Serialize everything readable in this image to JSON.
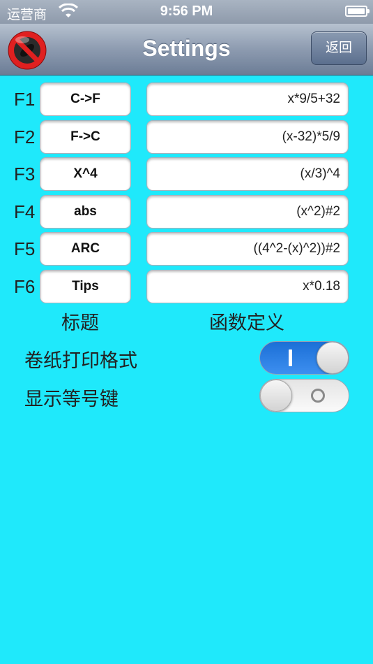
{
  "status_bar": {
    "carrier": "运营商",
    "time": "9:56 PM"
  },
  "nav": {
    "title": "Settings",
    "back_label": "返回",
    "left_icon": "no-symbol-icon"
  },
  "functions": [
    {
      "key": "F1",
      "title": "C->F",
      "definition": "x*9/5+32"
    },
    {
      "key": "F2",
      "title": "F->C",
      "definition": "(x-32)*5/9"
    },
    {
      "key": "F3",
      "title": "X^4",
      "definition": "(x/3)^4"
    },
    {
      "key": "F4",
      "title": "abs",
      "definition": "(x^2)#2"
    },
    {
      "key": "F5",
      "title": "ARC",
      "definition": "((4^2-(x)^2))#2"
    },
    {
      "key": "F6",
      "title": "Tips",
      "definition": "x*0.18"
    }
  ],
  "captions": {
    "title_column": "标题",
    "definition_column": "函数定义"
  },
  "options": [
    {
      "label": "卷纸打印格式",
      "enabled": true
    },
    {
      "label": "显示等号键",
      "enabled": false
    }
  ],
  "colors": {
    "background": "#1fe9fb",
    "toggle_on": "#2a7fe6"
  }
}
